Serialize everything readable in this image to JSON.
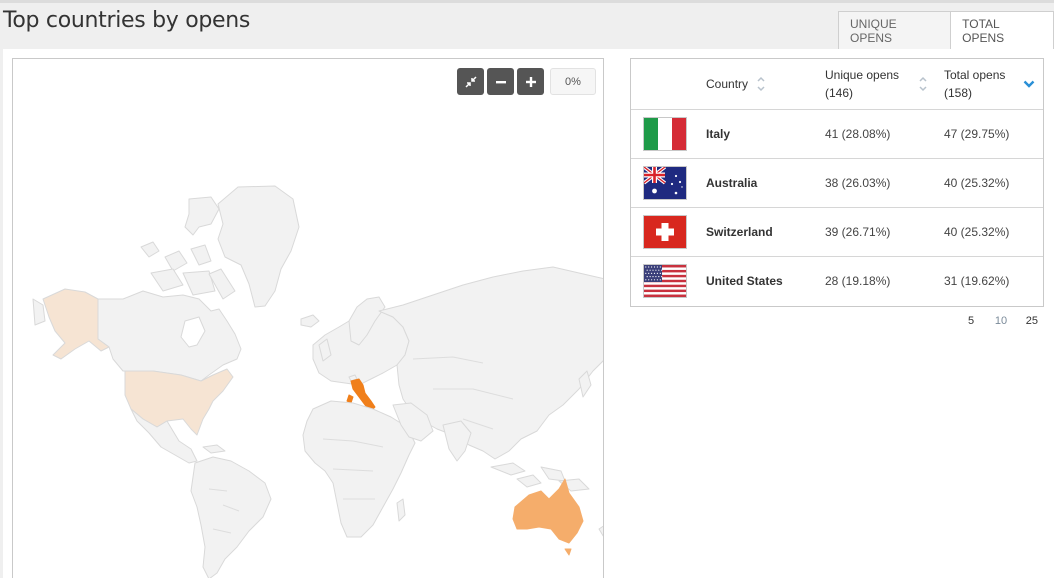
{
  "header": {
    "title": "Top countries by opens",
    "tabs": [
      {
        "label": "UNIQUE OPENS",
        "active": false
      },
      {
        "label": "TOTAL OPENS",
        "active": true
      }
    ]
  },
  "map": {
    "controls": {
      "reset_icon": "compress-arrows-icon",
      "zoom_out_icon": "minus-icon",
      "zoom_in_icon": "plus-icon",
      "zoom_level": "0%"
    },
    "colors": {
      "land": "#f2f2f2",
      "border": "#dcdcdc",
      "italy": "#f07f1a",
      "australia": "#f5ad6b",
      "united_states": "#f6e4d3"
    },
    "highlighted_countries": [
      "Italy",
      "Australia",
      "United States",
      "Switzerland"
    ]
  },
  "table": {
    "columns": {
      "country": "Country",
      "unique_opens": "Unique opens",
      "unique_opens_total": "(146)",
      "total_opens": "Total opens",
      "total_opens_total": "(158)"
    },
    "sort": {
      "column": "total_opens",
      "direction": "desc",
      "accent": "#2a8fd6"
    },
    "rows": [
      {
        "country": "Italy",
        "flag": "italy-flag",
        "unique": "41 (28.08%)",
        "total": "47 (29.75%)"
      },
      {
        "country": "Australia",
        "flag": "australia-flag",
        "unique": "38 (26.03%)",
        "total": "40 (25.32%)"
      },
      {
        "country": "Switzerland",
        "flag": "switzerland-flag",
        "unique": "39 (26.71%)",
        "total": "40 (25.32%)"
      },
      {
        "country": "United States",
        "flag": "united-states-flag",
        "unique": "28 (19.18%)",
        "total": "31 (19.62%)"
      }
    ],
    "page_sizes": [
      "5",
      "10",
      "25"
    ]
  }
}
